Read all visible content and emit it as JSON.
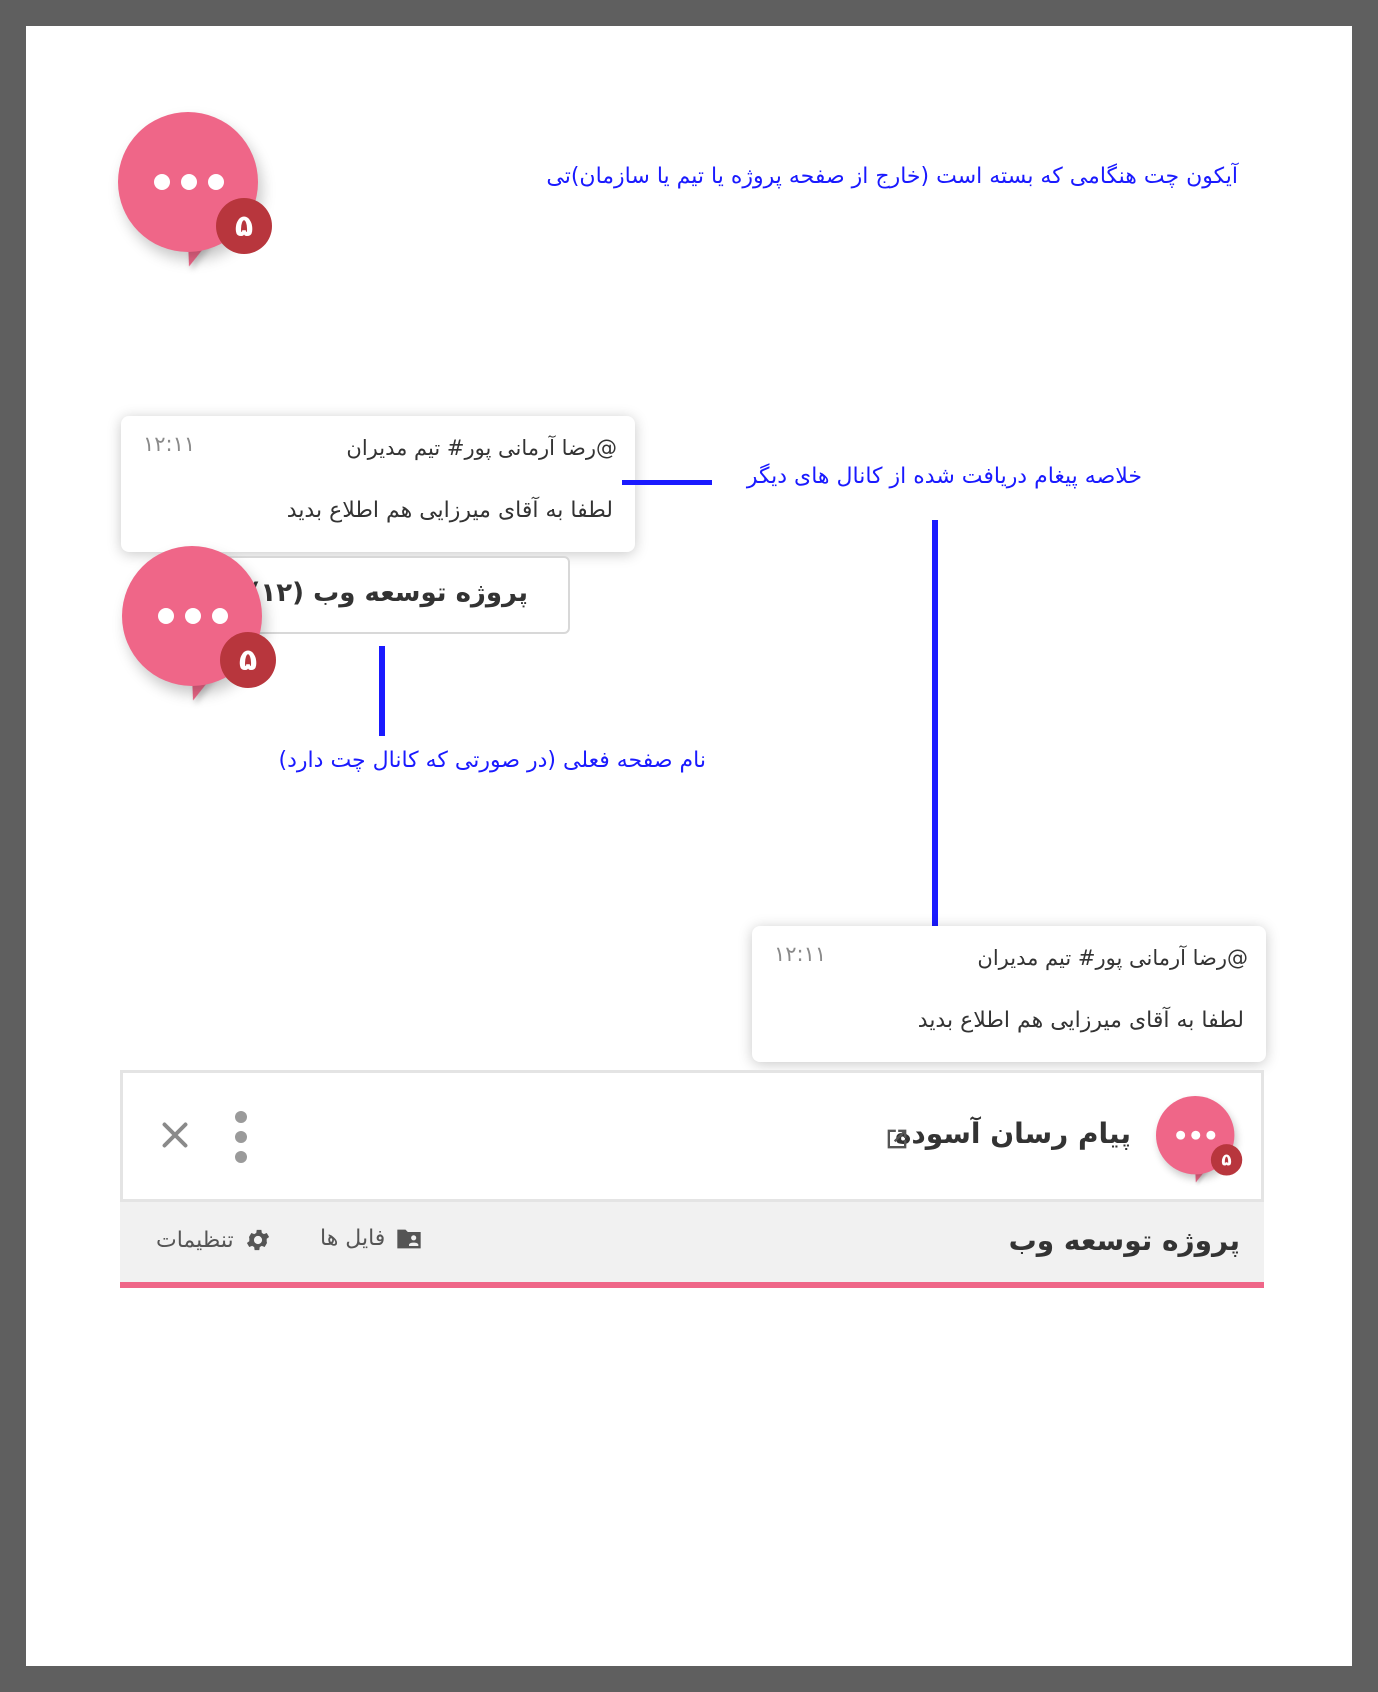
{
  "annotations": {
    "closed_icon": "آیکون چت هنگامی که بسته است (خارج از صفحه پروژه یا تیم یا سازمان)تی",
    "message_summary": "خلاصه پیغام دریافت شده از کانال های دیگر",
    "current_page": "نام صفحه فعلی (در صورتی که کانال چت دارد)"
  },
  "chat_icon": {
    "badge": "۵",
    "color": "#ef6688",
    "badge_color": "#b8363d"
  },
  "message": {
    "sender": "@رضا آرمانی پور# تیم مدیران",
    "time": "۱۲:۱۱",
    "text": "لطفا به آقای میرزایی هم اطلاع بدید"
  },
  "current_page_label": "پروژه توسعه وب (۱۲)",
  "messenger": {
    "title": "پیام رسان آسوده",
    "project_name": "پروژه توسعه وب",
    "tabs": {
      "files": "فایل ها",
      "settings": "تنظیمات"
    }
  }
}
